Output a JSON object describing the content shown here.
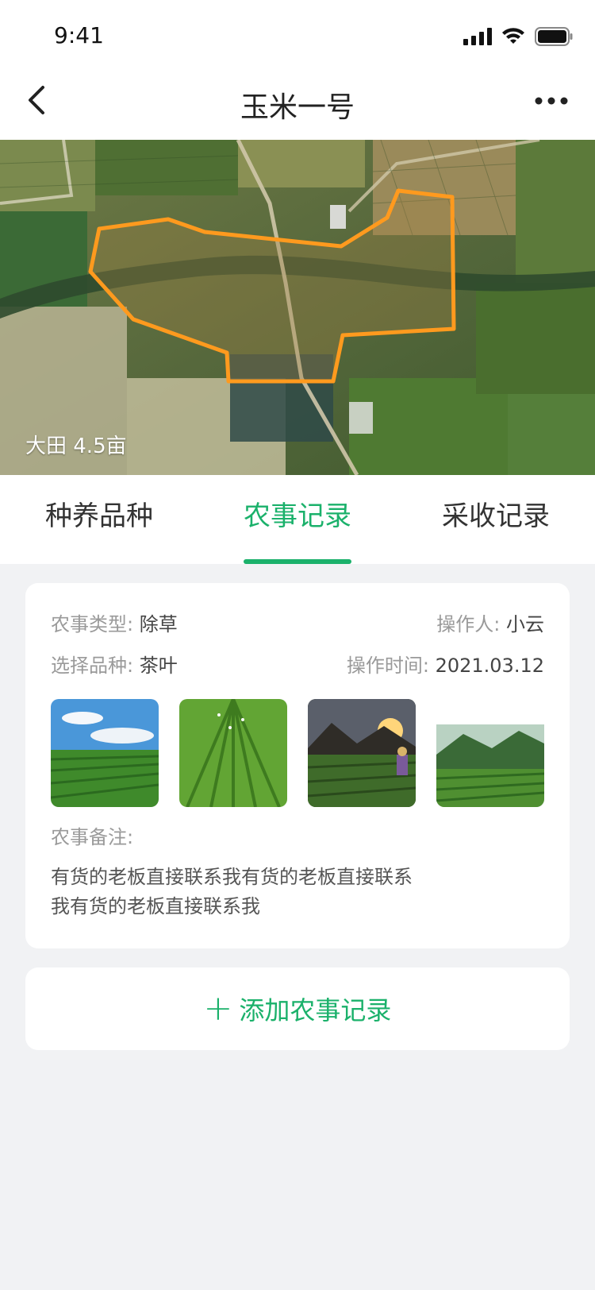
{
  "status": {
    "time": "9:41"
  },
  "nav": {
    "title": "玉米一号"
  },
  "map": {
    "caption": "大田 4.5亩"
  },
  "tabs": [
    {
      "label": "种养品种"
    },
    {
      "label": "农事记录"
    },
    {
      "label": "采收记录"
    }
  ],
  "record": {
    "farm_type_label": "农事类型:",
    "farm_type_value": "除草",
    "operator_label": "操作人:",
    "operator_value": "小云",
    "variety_label": "选择品种:",
    "variety_value": "茶叶",
    "time_label": "操作时间:",
    "time_value": "2021.03.12",
    "remark_label": "农事备注:",
    "remark_text": "有货的老板直接联系我有货的老板直接联系我有货的老板直接联系我"
  },
  "add_button": {
    "plus": "+",
    "label": "添加农事记录"
  },
  "colors": {
    "accent": "#1bb16b",
    "outline": "#ff9a1e"
  },
  "icons": {
    "back": "chevron-left-icon",
    "more": "ellipsis-icon",
    "signal": "signal-icon",
    "wifi": "wifi-icon",
    "battery": "battery-icon"
  }
}
